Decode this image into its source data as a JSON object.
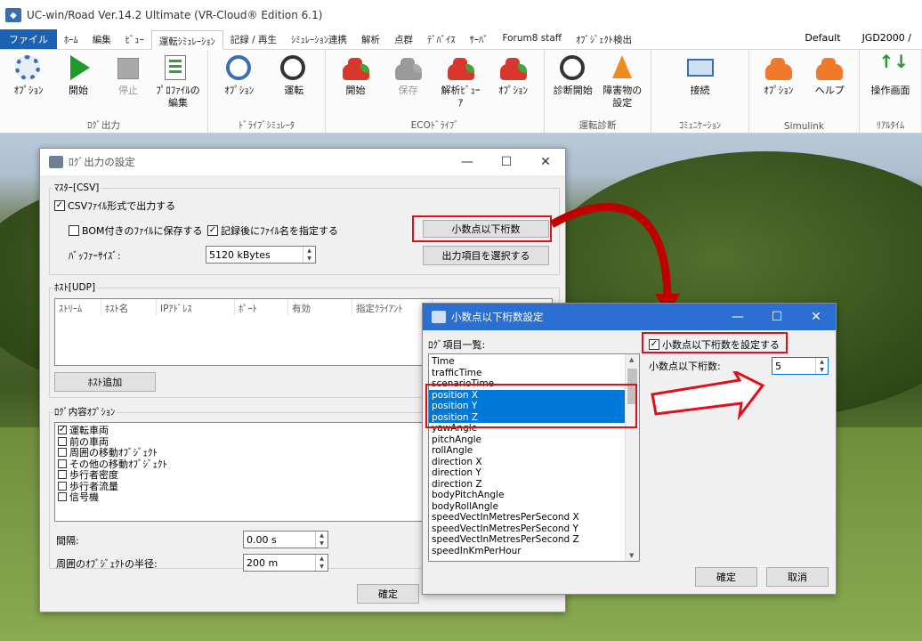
{
  "app": {
    "title": "UC-win/Road Ver.14.2 Ultimate (VR-Cloud® Edition 6.1)"
  },
  "menu": {
    "tabs": [
      "ファイル",
      "ﾎｰﾑ",
      "編集",
      "ﾋﾞｭｰ",
      "運転ｼﾐｭﾚｰｼｮﾝ",
      "記録 / 再生",
      "ｼﾐｭﾚｰｼｮﾝ連携",
      "解析",
      "点群",
      "ﾃﾞﾊﾞｲｽ",
      "ｻｰﾊﾞ",
      "Forum8 staff",
      "ｵﾌﾞｼﾞｪｸﾄ検出"
    ],
    "active": "運転ｼﾐｭﾚｰｼｮﾝ",
    "right": [
      "Default",
      "JGD2000 /"
    ]
  },
  "ribbon": {
    "groups": [
      {
        "label": "ﾛｸﾞ出力",
        "buttons": [
          {
            "label": "ｵﾌﾟｼｮﾝ",
            "icon": "gear-icon"
          },
          {
            "label": "開始",
            "icon": "play-icon"
          },
          {
            "label": "停止",
            "icon": "stop-icon",
            "disabled": true
          },
          {
            "label": "ﾌﾟﾛﾌｧｲﾙの\n編集",
            "icon": "profile-icon"
          }
        ]
      },
      {
        "label": "ﾄﾞﾗｲﾌﾞｼﾐｭﾚｰﾀ",
        "buttons": [
          {
            "label": "ｵﾌﾟｼｮﾝ",
            "icon": "steering-gear-icon"
          },
          {
            "label": "運転",
            "icon": "steering-icon"
          }
        ]
      },
      {
        "label": "ECOﾄﾞﾗｲﾌﾞ",
        "buttons": [
          {
            "label": "開始",
            "icon": "eco-car-icon"
          },
          {
            "label": "保存",
            "icon": "eco-save-icon",
            "disabled": true
          },
          {
            "label": "解析ﾋﾞｭｰ\nｱ",
            "icon": "eco-analysis-icon"
          },
          {
            "label": "ｵﾌﾟｼｮﾝ",
            "icon": "eco-option-icon"
          }
        ]
      },
      {
        "label": "運転診断",
        "buttons": [
          {
            "label": "診断開始",
            "icon": "diagnosis-icon"
          },
          {
            "label": "障害物の\n設定",
            "icon": "cone-icon"
          }
        ]
      },
      {
        "label": "ｺﾐｭﾆｹｰｼｮﾝ",
        "buttons": [
          {
            "label": "接続",
            "icon": "network-icon"
          }
        ]
      },
      {
        "label": "Simulink",
        "buttons": [
          {
            "label": "ｵﾌﾟｼｮﾝ",
            "icon": "simulink-option-icon"
          },
          {
            "label": "ヘルプ",
            "icon": "simulink-help-icon"
          }
        ]
      },
      {
        "label": "ﾘｱﾙﾀｲﾑ",
        "buttons": [
          {
            "label": "操作画面",
            "icon": "realtime-icon"
          }
        ]
      }
    ]
  },
  "logwin": {
    "title": "ﾛｸﾞ出力の設定",
    "master_label": "ﾏｽﾀｰ[CSV]",
    "csv_output": "CSVﾌｧｲﾙ形式で出力する",
    "bom": "BOM付きのﾌｧｲﾙに保存する",
    "filename": "記録後にﾌｧｲﾙ名を指定する",
    "decimal_button": "小数点以下桁数",
    "buffer_label": "ﾊﾞｯﾌｧｰｻｲｽﾞ:",
    "buffer_value": "5120 kBytes",
    "select_items_button": "出力項目を選択する",
    "host_label": "ﾎｽﾄ[UDP]",
    "host_headers": [
      "ｽﾄﾘｰﾑ",
      "ﾎｽﾄ名",
      "IPｱﾄﾞﾚｽ",
      "ﾎﾟｰﾄ",
      "有効",
      "指定ｸﾗｲｱﾝﾄ"
    ],
    "add_host_button": "ﾎｽﾄ追加",
    "content_label": "ﾛｸﾞ内容ｵﾌﾟｼｮﾝ",
    "content_items": [
      {
        "label": "運転車両",
        "checked": true
      },
      {
        "label": "前の車両",
        "checked": false
      },
      {
        "label": "周囲の移動ｵﾌﾞｼﾞｪｸﾄ",
        "checked": false
      },
      {
        "label": "その他の移動ｵﾌﾞｼﾞｪｸﾄ",
        "checked": false
      },
      {
        "label": "歩行者密度",
        "checked": false
      },
      {
        "label": "歩行者流量",
        "checked": false
      },
      {
        "label": "信号機",
        "checked": false
      }
    ],
    "interval_label": "間隔:",
    "interval_value": "0.00 s",
    "radius_label": "周囲のｵﾌﾞｼﾞｪｸﾄの半径:",
    "radius_value": "200 m",
    "ok_button": "確定"
  },
  "decwin": {
    "title": "小数点以下桁数設定",
    "list_label": "ﾛｸﾞ項目一覧:",
    "items": [
      "Time",
      "trafficTime",
      "scenarioTime",
      "position X",
      "position Y",
      "position Z",
      "yawAngle",
      "pitchAngle",
      "rollAngle",
      "direction X",
      "direction Y",
      "direction Z",
      "bodyPitchAngle",
      "bodyRollAngle",
      "speedVectInMetresPerSecond X",
      "speedVectInMetresPerSecond Y",
      "speedVectInMetresPerSecond Z",
      "speedInKmPerHour"
    ],
    "selected": [
      "position X",
      "position Y",
      "position Z"
    ],
    "set_checkbox": "小数点以下桁数を設定する",
    "digits_label": "小数点以下桁数:",
    "digits_value": "5",
    "ok_button": "確定",
    "cancel_button": "取消"
  },
  "colors": {
    "accent": "#0078d7",
    "highlight": "#e0101b",
    "titlebar_active": "#2b6fd3"
  }
}
